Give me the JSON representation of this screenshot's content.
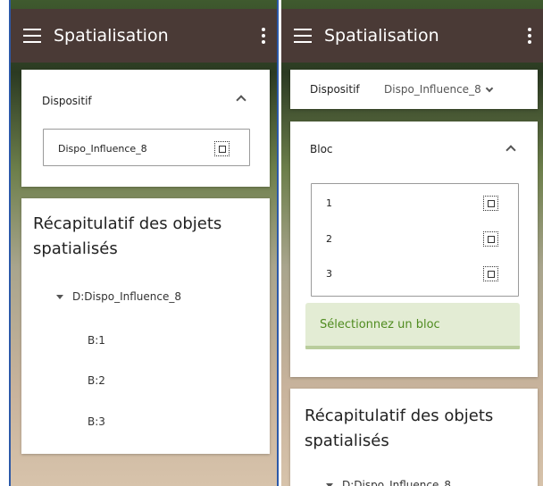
{
  "left_screen": {
    "app_title": "Spatialisation",
    "dispositif_card": {
      "title": "Dispositif",
      "selected_value": "Dispo_Influence_8"
    },
    "recap_card": {
      "title": "Récapitulatif des objets spatialisés",
      "tree_root": "D:Dispo_Influence_8",
      "tree_children": [
        "B:1",
        "B:2",
        "B:3"
      ]
    }
  },
  "right_screen": {
    "app_title": "Spatialisation",
    "dispositif_bar": {
      "label": "Dispositif",
      "selected_value": "Dispo_Influence_8"
    },
    "bloc_card": {
      "title": "Bloc",
      "options": [
        "1",
        "2",
        "3"
      ],
      "prompt": "Sélectionnez un bloc"
    },
    "recap_card": {
      "title": "Récapitulatif des objets spatialisés",
      "tree_root": "D:Dispo_Influence_8"
    }
  },
  "colors": {
    "appbar": "#4a3a36",
    "accent_green": "#4f8b1f",
    "chip_background": "#e3ecd4",
    "frame_border": "#2c59a8"
  },
  "icons": [
    "menu-icon",
    "more-vert-icon",
    "chevron-up-icon",
    "chevron-down-icon",
    "focus-icon",
    "caret-down-icon"
  ]
}
